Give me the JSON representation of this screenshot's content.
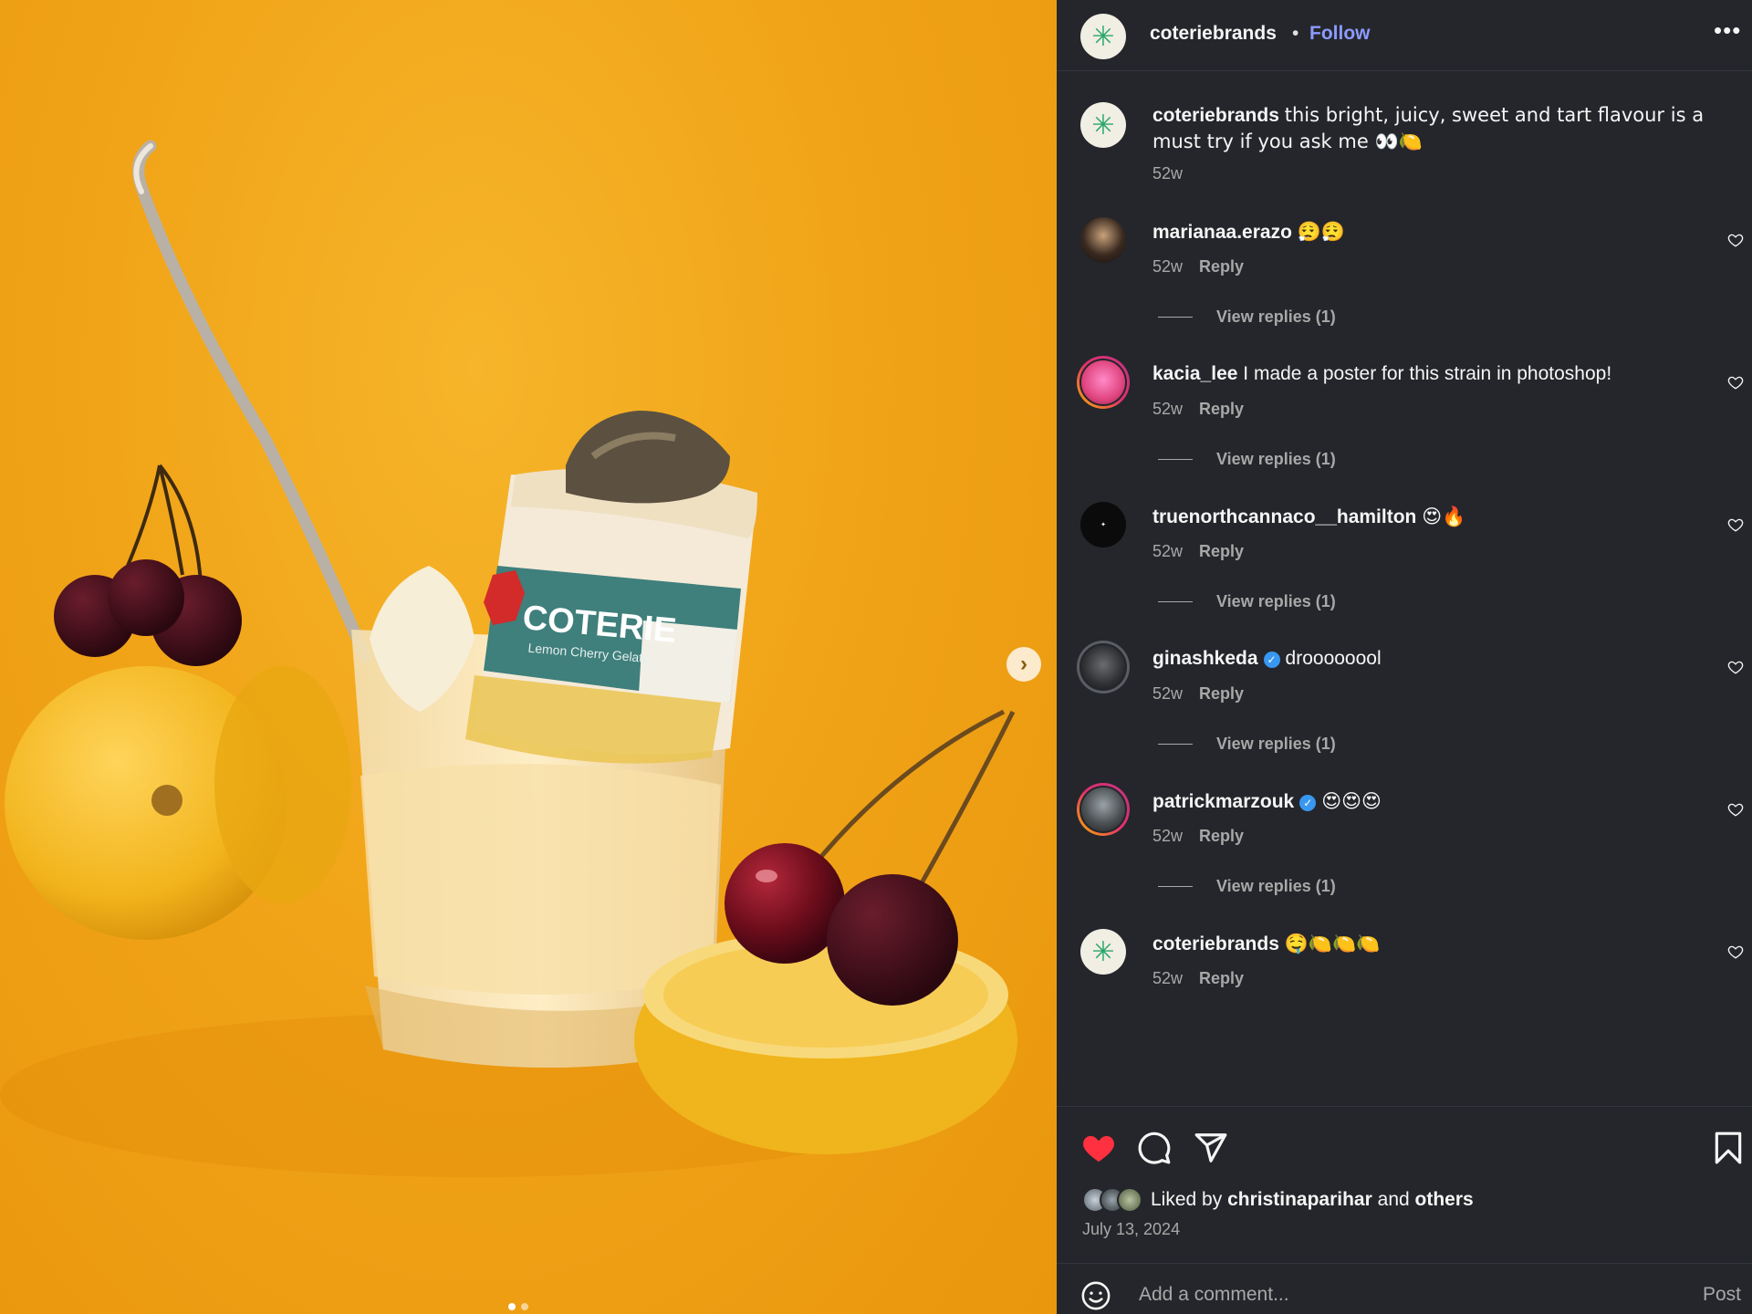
{
  "post": {
    "author": "coteriebrands",
    "separator": "•",
    "follow_label": "Follow",
    "more_label": "•••",
    "image_brand_text": "COTERIE",
    "image_product_text": "Lemon Cherry Gelato",
    "carousel": {
      "count": 2,
      "active": 0
    }
  },
  "caption": {
    "user": "coteriebrands",
    "text": "this bright, juicy, sweet and tart flavour is a must try if you ask me 👀🍋",
    "time": "52w"
  },
  "comments": [
    {
      "user": "marianaa.erazo",
      "verified": false,
      "text": "😮‍💨😮‍💨",
      "time": "52w",
      "reply_label": "Reply",
      "view_replies": "View replies (1)"
    },
    {
      "user": "kacia_lee",
      "verified": false,
      "text": "I made a poster for this strain in photoshop!",
      "time": "52w",
      "reply_label": "Reply",
      "view_replies": "View replies (1)"
    },
    {
      "user": "truenorthcannaco__hamilton",
      "verified": false,
      "text": "😍🔥",
      "time": "52w",
      "reply_label": "Reply",
      "view_replies": "View replies (1)"
    },
    {
      "user": "ginashkeda",
      "verified": true,
      "text": "droooooool",
      "time": "52w",
      "reply_label": "Reply",
      "view_replies": "View replies (1)"
    },
    {
      "user": "patrickmarzouk",
      "verified": true,
      "text": "😍😍😍",
      "time": "52w",
      "reply_label": "Reply",
      "view_replies": "View replies (1)"
    },
    {
      "user": "coteriebrands",
      "verified": false,
      "text": "🤤🍋🍋🍋",
      "time": "52w",
      "reply_label": "Reply",
      "view_replies": ""
    }
  ],
  "likes": {
    "prefix": "Liked by",
    "user": "christinaparihar",
    "conjunction": "and",
    "others": "others",
    "date": "July 13, 2024"
  },
  "composer": {
    "placeholder": "Add a comment...",
    "post_label": "Post"
  },
  "colors": {
    "panel_bg": "#24262b",
    "follow": "#8c9bff",
    "like_red": "#ff3040",
    "verified": "#3897f0",
    "photo_bg": "#f1a418"
  },
  "icons": [
    "heart-icon",
    "comment-icon",
    "share-icon",
    "bookmark-icon",
    "more-icon",
    "chevron-right-icon",
    "emoji-icon",
    "verified-badge-icon"
  ]
}
